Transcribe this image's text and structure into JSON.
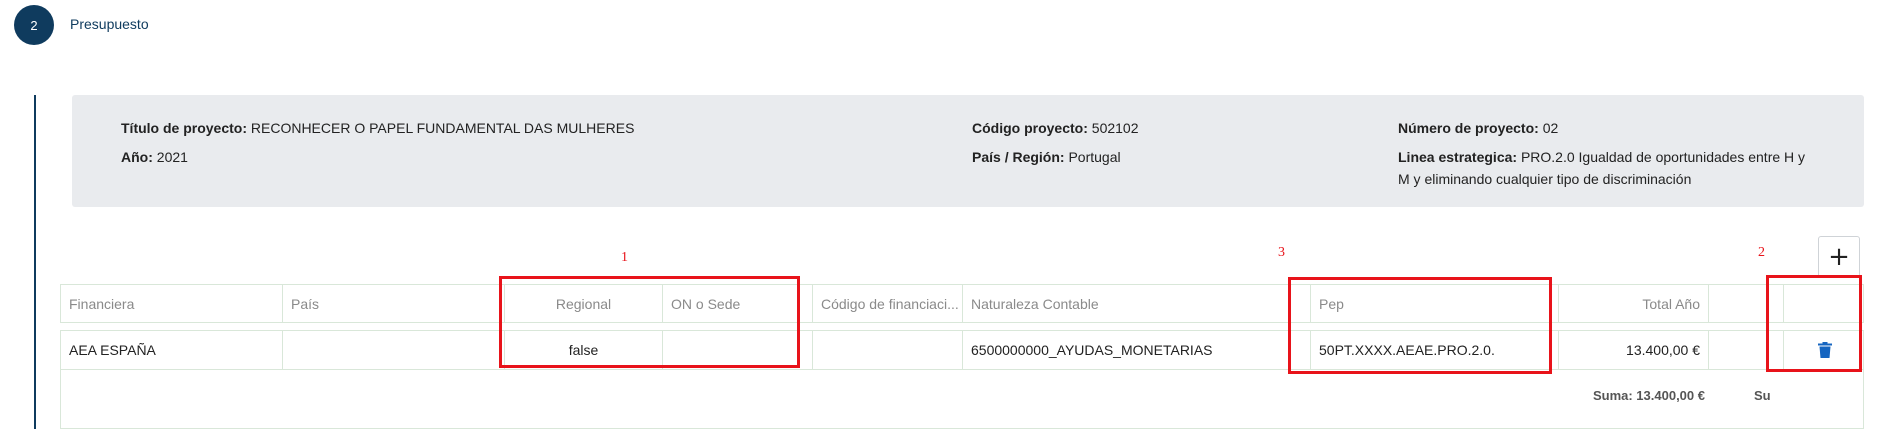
{
  "step": {
    "number": "2",
    "title": "Presupuesto"
  },
  "project_info": {
    "titulo_label": "Título de proyecto:",
    "titulo_value": "RECONHECER O PAPEL FUNDAMENTAL DAS MULHERES",
    "anio_label": "Año:",
    "anio_value": "2021",
    "codigo_label": "Código proyecto:",
    "codigo_value": "502102",
    "pais_label": "País / Región:",
    "pais_value": "Portugal",
    "numero_label": "Número de proyecto:",
    "numero_value": "02",
    "linea_label": "Linea estrategica:",
    "linea_value_line1": "PRO.2.0 Igualdad de oportunidades entre H y",
    "linea_value_line2": "M y eliminando cualquier tipo de discriminación"
  },
  "toolbar": {
    "add_label": "+"
  },
  "table": {
    "headers": {
      "financiera": "Financiera",
      "pais": "País",
      "regional": "Regional",
      "on_sede": "ON o Sede",
      "codigo_financiacion": "Código de financiaci...",
      "naturaleza": "Naturaleza Contable",
      "pep": "Pep",
      "total_anio": "Total Año"
    },
    "row": {
      "financiera": "AEA ESPAÑA",
      "pais": "",
      "regional": "false",
      "on_sede": "",
      "codigo_financiacion": "",
      "naturaleza": "6500000000_AYUDAS_MONETARIAS",
      "pep": "50PT.XXXX.AEAE.PRO.2.0.",
      "total_anio": "13.400,00 €"
    },
    "sum_label": "Suma: 13.400,00 €",
    "sum_partial": "Su"
  },
  "annotations": {
    "n1": "1",
    "n2": "2",
    "n3": "3"
  },
  "colors": {
    "accent": "#0f3b5e",
    "annotation": "#e8131a",
    "delete_icon": "#1565c0"
  }
}
